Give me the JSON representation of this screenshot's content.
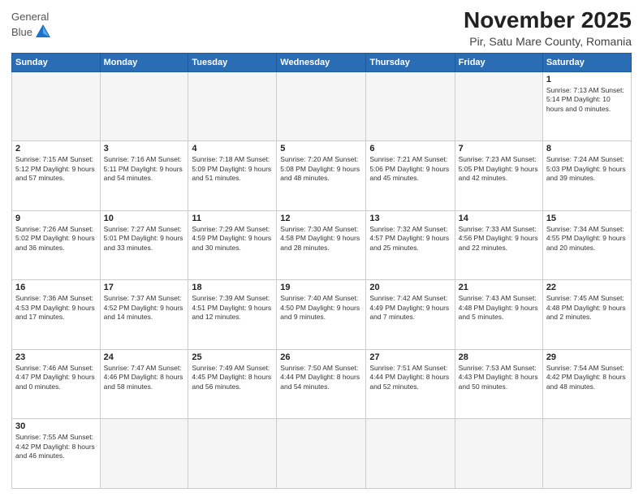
{
  "logo": {
    "text_general": "General",
    "text_blue": "Blue"
  },
  "title": "November 2025",
  "subtitle": "Pir, Satu Mare County, Romania",
  "days_of_week": [
    "Sunday",
    "Monday",
    "Tuesday",
    "Wednesday",
    "Thursday",
    "Friday",
    "Saturday"
  ],
  "weeks": [
    [
      {
        "day": "",
        "info": ""
      },
      {
        "day": "",
        "info": ""
      },
      {
        "day": "",
        "info": ""
      },
      {
        "day": "",
        "info": ""
      },
      {
        "day": "",
        "info": ""
      },
      {
        "day": "",
        "info": ""
      },
      {
        "day": "1",
        "info": "Sunrise: 7:13 AM\nSunset: 5:14 PM\nDaylight: 10 hours and 0 minutes."
      }
    ],
    [
      {
        "day": "2",
        "info": "Sunrise: 7:15 AM\nSunset: 5:12 PM\nDaylight: 9 hours and 57 minutes."
      },
      {
        "day": "3",
        "info": "Sunrise: 7:16 AM\nSunset: 5:11 PM\nDaylight: 9 hours and 54 minutes."
      },
      {
        "day": "4",
        "info": "Sunrise: 7:18 AM\nSunset: 5:09 PM\nDaylight: 9 hours and 51 minutes."
      },
      {
        "day": "5",
        "info": "Sunrise: 7:20 AM\nSunset: 5:08 PM\nDaylight: 9 hours and 48 minutes."
      },
      {
        "day": "6",
        "info": "Sunrise: 7:21 AM\nSunset: 5:06 PM\nDaylight: 9 hours and 45 minutes."
      },
      {
        "day": "7",
        "info": "Sunrise: 7:23 AM\nSunset: 5:05 PM\nDaylight: 9 hours and 42 minutes."
      },
      {
        "day": "8",
        "info": "Sunrise: 7:24 AM\nSunset: 5:03 PM\nDaylight: 9 hours and 39 minutes."
      }
    ],
    [
      {
        "day": "9",
        "info": "Sunrise: 7:26 AM\nSunset: 5:02 PM\nDaylight: 9 hours and 36 minutes."
      },
      {
        "day": "10",
        "info": "Sunrise: 7:27 AM\nSunset: 5:01 PM\nDaylight: 9 hours and 33 minutes."
      },
      {
        "day": "11",
        "info": "Sunrise: 7:29 AM\nSunset: 4:59 PM\nDaylight: 9 hours and 30 minutes."
      },
      {
        "day": "12",
        "info": "Sunrise: 7:30 AM\nSunset: 4:58 PM\nDaylight: 9 hours and 28 minutes."
      },
      {
        "day": "13",
        "info": "Sunrise: 7:32 AM\nSunset: 4:57 PM\nDaylight: 9 hours and 25 minutes."
      },
      {
        "day": "14",
        "info": "Sunrise: 7:33 AM\nSunset: 4:56 PM\nDaylight: 9 hours and 22 minutes."
      },
      {
        "day": "15",
        "info": "Sunrise: 7:34 AM\nSunset: 4:55 PM\nDaylight: 9 hours and 20 minutes."
      }
    ],
    [
      {
        "day": "16",
        "info": "Sunrise: 7:36 AM\nSunset: 4:53 PM\nDaylight: 9 hours and 17 minutes."
      },
      {
        "day": "17",
        "info": "Sunrise: 7:37 AM\nSunset: 4:52 PM\nDaylight: 9 hours and 14 minutes."
      },
      {
        "day": "18",
        "info": "Sunrise: 7:39 AM\nSunset: 4:51 PM\nDaylight: 9 hours and 12 minutes."
      },
      {
        "day": "19",
        "info": "Sunrise: 7:40 AM\nSunset: 4:50 PM\nDaylight: 9 hours and 9 minutes."
      },
      {
        "day": "20",
        "info": "Sunrise: 7:42 AM\nSunset: 4:49 PM\nDaylight: 9 hours and 7 minutes."
      },
      {
        "day": "21",
        "info": "Sunrise: 7:43 AM\nSunset: 4:48 PM\nDaylight: 9 hours and 5 minutes."
      },
      {
        "day": "22",
        "info": "Sunrise: 7:45 AM\nSunset: 4:48 PM\nDaylight: 9 hours and 2 minutes."
      }
    ],
    [
      {
        "day": "23",
        "info": "Sunrise: 7:46 AM\nSunset: 4:47 PM\nDaylight: 9 hours and 0 minutes."
      },
      {
        "day": "24",
        "info": "Sunrise: 7:47 AM\nSunset: 4:46 PM\nDaylight: 8 hours and 58 minutes."
      },
      {
        "day": "25",
        "info": "Sunrise: 7:49 AM\nSunset: 4:45 PM\nDaylight: 8 hours and 56 minutes."
      },
      {
        "day": "26",
        "info": "Sunrise: 7:50 AM\nSunset: 4:44 PM\nDaylight: 8 hours and 54 minutes."
      },
      {
        "day": "27",
        "info": "Sunrise: 7:51 AM\nSunset: 4:44 PM\nDaylight: 8 hours and 52 minutes."
      },
      {
        "day": "28",
        "info": "Sunrise: 7:53 AM\nSunset: 4:43 PM\nDaylight: 8 hours and 50 minutes."
      },
      {
        "day": "29",
        "info": "Sunrise: 7:54 AM\nSunset: 4:42 PM\nDaylight: 8 hours and 48 minutes."
      }
    ],
    [
      {
        "day": "30",
        "info": "Sunrise: 7:55 AM\nSunset: 4:42 PM\nDaylight: 8 hours and 46 minutes."
      },
      {
        "day": "",
        "info": ""
      },
      {
        "day": "",
        "info": ""
      },
      {
        "day": "",
        "info": ""
      },
      {
        "day": "",
        "info": ""
      },
      {
        "day": "",
        "info": ""
      },
      {
        "day": "",
        "info": ""
      }
    ]
  ]
}
